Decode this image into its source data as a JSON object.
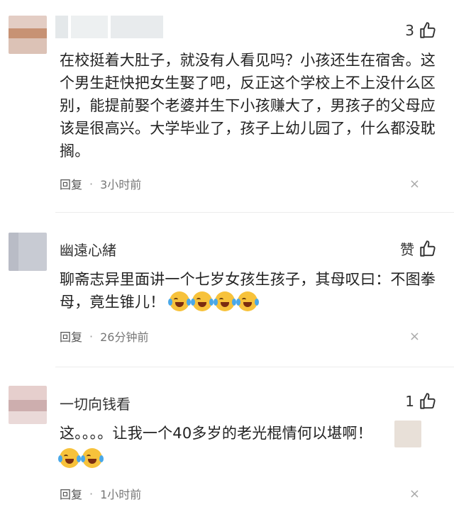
{
  "comments": [
    {
      "username": "",
      "likes": "3",
      "text": "在校挺着大肚子，就没有人看见吗？小孩还生在宿舍。这个男生赶快把女生娶了吧，反正这个学校上不上没什么区别，能提前娶个老婆并生下小孩赚大了，男孩子的父母应该是很高兴。大学毕业了，孩子上幼儿园了，什么都没耽搁。",
      "reply": "回复",
      "time": "3小时前",
      "close": "×"
    },
    {
      "username": "幽遠心緒",
      "likes": "赞",
      "text": "聊斋志异里面讲一个七岁女孩生孩子，其母叹曰：不图拳母，竟生锥儿！",
      "emoji_count": 4,
      "reply": "回复",
      "time": "26分钟前",
      "close": "×"
    },
    {
      "username": "一切向钱看",
      "likes": "1",
      "text": "这。。。。让我一个40多岁的老光棍情何以堪啊！",
      "emoji_count": 2,
      "reply": "回复",
      "time": "1小时前",
      "close": "×"
    }
  ],
  "colors": {
    "avatar1": [
      "#dfc6bd",
      "#c88f70",
      "#e6d8d2"
    ],
    "avatar2": [
      "#c8cbd3",
      "#d9dbe0"
    ],
    "avatar3": [
      "#e3c9c7",
      "#c9a9a9",
      "#eedcdc"
    ],
    "emoji": "#f7c23b"
  },
  "icons": {
    "like": "thumbs-up-icon",
    "close": "close-icon",
    "emoji": "laughing-crying-emoji-icon"
  }
}
